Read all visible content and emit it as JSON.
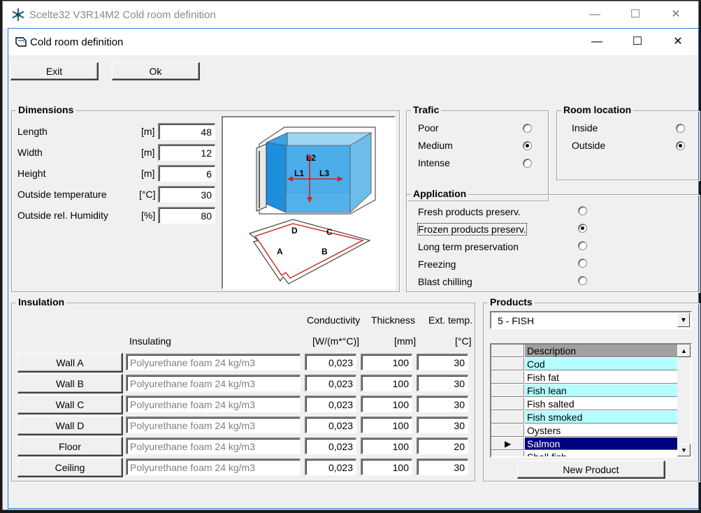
{
  "outer_window": {
    "title": "Scelte32 V3R14M2 Cold room definition"
  },
  "window": {
    "title": "Cold room definition"
  },
  "toolbar": {
    "exit_label": "Exit",
    "ok_label": "Ok"
  },
  "dimensions": {
    "title": "Dimensions",
    "rows": [
      {
        "label": "Length",
        "unit": "[m]",
        "value": "48"
      },
      {
        "label": "Width",
        "unit": "[m]",
        "value": "12"
      },
      {
        "label": "Height",
        "unit": "[m]",
        "value": "6"
      },
      {
        "label": "Outside temperature",
        "unit": "[°C]",
        "value": "30"
      },
      {
        "label": "Outside rel. Humidity",
        "unit": "[%]",
        "value": "80"
      }
    ]
  },
  "diagram": {
    "labels": {
      "l1": "L1",
      "l2": "L2",
      "l3": "L3",
      "a": "A",
      "b": "B",
      "c": "C",
      "d": "D"
    }
  },
  "trafic": {
    "title": "Trafic",
    "options": [
      {
        "label": "Poor",
        "selected": false
      },
      {
        "label": "Medium",
        "selected": true
      },
      {
        "label": "Intense",
        "selected": false
      }
    ]
  },
  "room_location": {
    "title": "Room location",
    "options": [
      {
        "label": "Inside",
        "selected": false
      },
      {
        "label": "Outside",
        "selected": true
      }
    ]
  },
  "application": {
    "title": "Application",
    "options": [
      {
        "label": "Fresh products preserv.",
        "selected": false
      },
      {
        "label": "Frozen products preserv.",
        "selected": true
      },
      {
        "label": "Long term preservation",
        "selected": false
      },
      {
        "label": "Freezing",
        "selected": false
      },
      {
        "label": "Blast chilling",
        "selected": false
      }
    ]
  },
  "insulation": {
    "title": "Insulation",
    "headers": {
      "insulating": "Insulating",
      "conductivity": "Conductivity",
      "conductivity_unit": "[W/(m*°C)]",
      "thickness": "Thickness",
      "thickness_unit": "[mm]",
      "ext_temp": "Ext. temp.",
      "ext_temp_unit": "[°C]"
    },
    "rows": [
      {
        "name": "Wall A",
        "material": "Polyurethane foam 24 kg/m3",
        "conductivity": "0,023",
        "thickness": "100",
        "ext_temp": "30"
      },
      {
        "name": "Wall B",
        "material": "Polyurethane foam 24 kg/m3",
        "conductivity": "0,023",
        "thickness": "100",
        "ext_temp": "30"
      },
      {
        "name": "Wall C",
        "material": "Polyurethane foam 24 kg/m3",
        "conductivity": "0,023",
        "thickness": "100",
        "ext_temp": "30"
      },
      {
        "name": "Wall D",
        "material": "Polyurethane foam 24 kg/m3",
        "conductivity": "0,023",
        "thickness": "100",
        "ext_temp": "30"
      },
      {
        "name": "Floor",
        "material": "Polyurethane foam 24 kg/m3",
        "conductivity": "0,023",
        "thickness": "100",
        "ext_temp": "20"
      },
      {
        "name": "Ceiling",
        "material": "Polyurethane foam 24 kg/m3",
        "conductivity": "0,023",
        "thickness": "100",
        "ext_temp": "30"
      }
    ]
  },
  "products": {
    "title": "Products",
    "category": "5 - FISH",
    "column_header": "Description",
    "items": [
      {
        "name": "Cod",
        "highlight": "cyan"
      },
      {
        "name": "Fish fat",
        "highlight": "none"
      },
      {
        "name": "Fish lean",
        "highlight": "cyan"
      },
      {
        "name": "Fish salted",
        "highlight": "none"
      },
      {
        "name": "Fish smoked",
        "highlight": "cyan"
      },
      {
        "name": "Oysters",
        "highlight": "none"
      },
      {
        "name": "Salmon",
        "highlight": "selected"
      },
      {
        "name": "Shell fish",
        "highlight": "none"
      }
    ],
    "new_product_label": "New Product"
  },
  "colors": {
    "cyan_row": "#b4ffff",
    "selected_row": "#000080",
    "room_blue": "#1e90ff"
  }
}
